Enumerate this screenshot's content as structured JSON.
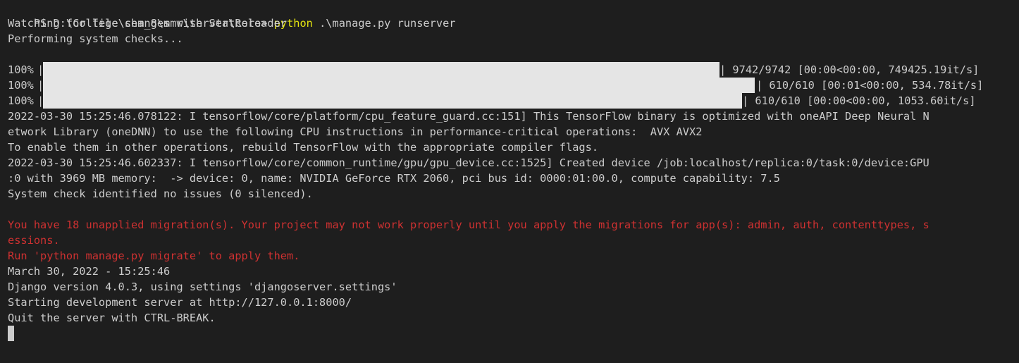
{
  "terminal": {
    "prompt": {
      "path": "PS D:\\College\\sem_8\\mmr\\server\\core> ",
      "command": "python",
      "args": " .\\manage.py runserver"
    },
    "lines_top": [
      "Watching for file changes with StatReloader",
      "Performing system checks..."
    ],
    "progress_bars": [
      {
        "percent_label": "100%",
        "progress": 1.0,
        "stats": "| 9742/9742 [00:00<00:00, 749425.19it/s]"
      },
      {
        "percent_label": "100%",
        "progress": 1.0,
        "stats": "| 610/610 [00:01<00:00, 534.78it/s]"
      },
      {
        "percent_label": "100%",
        "progress": 1.0,
        "stats": "| 610/610 [00:00<00:00, 1053.60it/s]"
      }
    ],
    "log_lines": [
      "2022-03-30 15:25:46.078122: I tensorflow/core/platform/cpu_feature_guard.cc:151] This TensorFlow binary is optimized with oneAPI Deep Neural N",
      "etwork Library (oneDNN) to use the following CPU instructions in performance-critical operations:  AVX AVX2",
      "To enable them in other operations, rebuild TensorFlow with the appropriate compiler flags.",
      "2022-03-30 15:25:46.602337: I tensorflow/core/common_runtime/gpu/gpu_device.cc:1525] Created device /job:localhost/replica:0/task:0/device:GPU",
      ":0 with 3969 MB memory:  -> device: 0, name: NVIDIA GeForce RTX 2060, pci bus id: 0000:01:00.0, compute capability: 7.5",
      "System check identified no issues (0 silenced)."
    ],
    "warning_lines": [
      "You have 18 unapplied migration(s). Your project may not work properly until you apply the migrations for app(s): admin, auth, contenttypes, s",
      "essions.",
      "Run 'python manage.py migrate' to apply them."
    ],
    "footer_lines": [
      "March 30, 2022 - 15:25:46",
      "Django version 4.0.3, using settings 'djangoserver.settings'",
      "Starting development server at http://127.0.0.1:8000/",
      "Quit the server with CTRL-BREAK."
    ],
    "colors": {
      "background": "#1e1e1e",
      "text": "#cccccc",
      "command": "#e5e510",
      "warning": "#cd3131",
      "bar": "#e5e5e5"
    }
  }
}
